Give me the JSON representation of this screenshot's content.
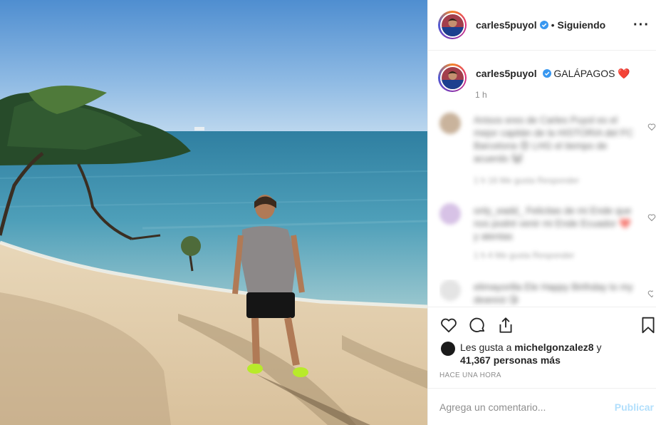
{
  "header": {
    "username": "carles5puyol",
    "separator": "•",
    "follow_label": "Siguiendo",
    "more_label": "···"
  },
  "caption": {
    "username": "carles5puyol",
    "text": "GALÁPAGOS ❤️",
    "time": "1 h"
  },
  "comments": [
    {
      "text": "Anisos eres de Carles Puyol es el mejor capitán de la HISTORIA del FC Barcelona 😍 LHG el tiempo de acuerdo 🐼",
      "meta": "1 h   16 Me gusta   Responder"
    },
    {
      "text": "only_eadd_ Felicitas de mi Ende que nos podré venir mi Ende Ecuador ❤️ y atentas",
      "meta": "1 h   4 Me gusta   Responder"
    },
    {
      "text": "elimayorilla Ele Happy Birthday to my dearest 😘",
      "meta": ""
    }
  ],
  "likes": {
    "prefix": "Les gusta a",
    "user": "michelgonzalez8",
    "conj": "y",
    "count": "41,367 personas más"
  },
  "timestamp": "HACE UNA HORA",
  "comment_box": {
    "placeholder": "Agrega un comentario...",
    "publish_label": "Publicar"
  },
  "colors": {
    "verified_blue": "#3897f0",
    "heart_red": "#e0245e",
    "publish_disabled": "#b2dffc",
    "secondary_text": "#8e8e8e"
  },
  "icons": [
    "verified-badge-icon",
    "more-options-icon",
    "like-heart-icon",
    "comment-icon",
    "share-icon",
    "bookmark-icon"
  ]
}
